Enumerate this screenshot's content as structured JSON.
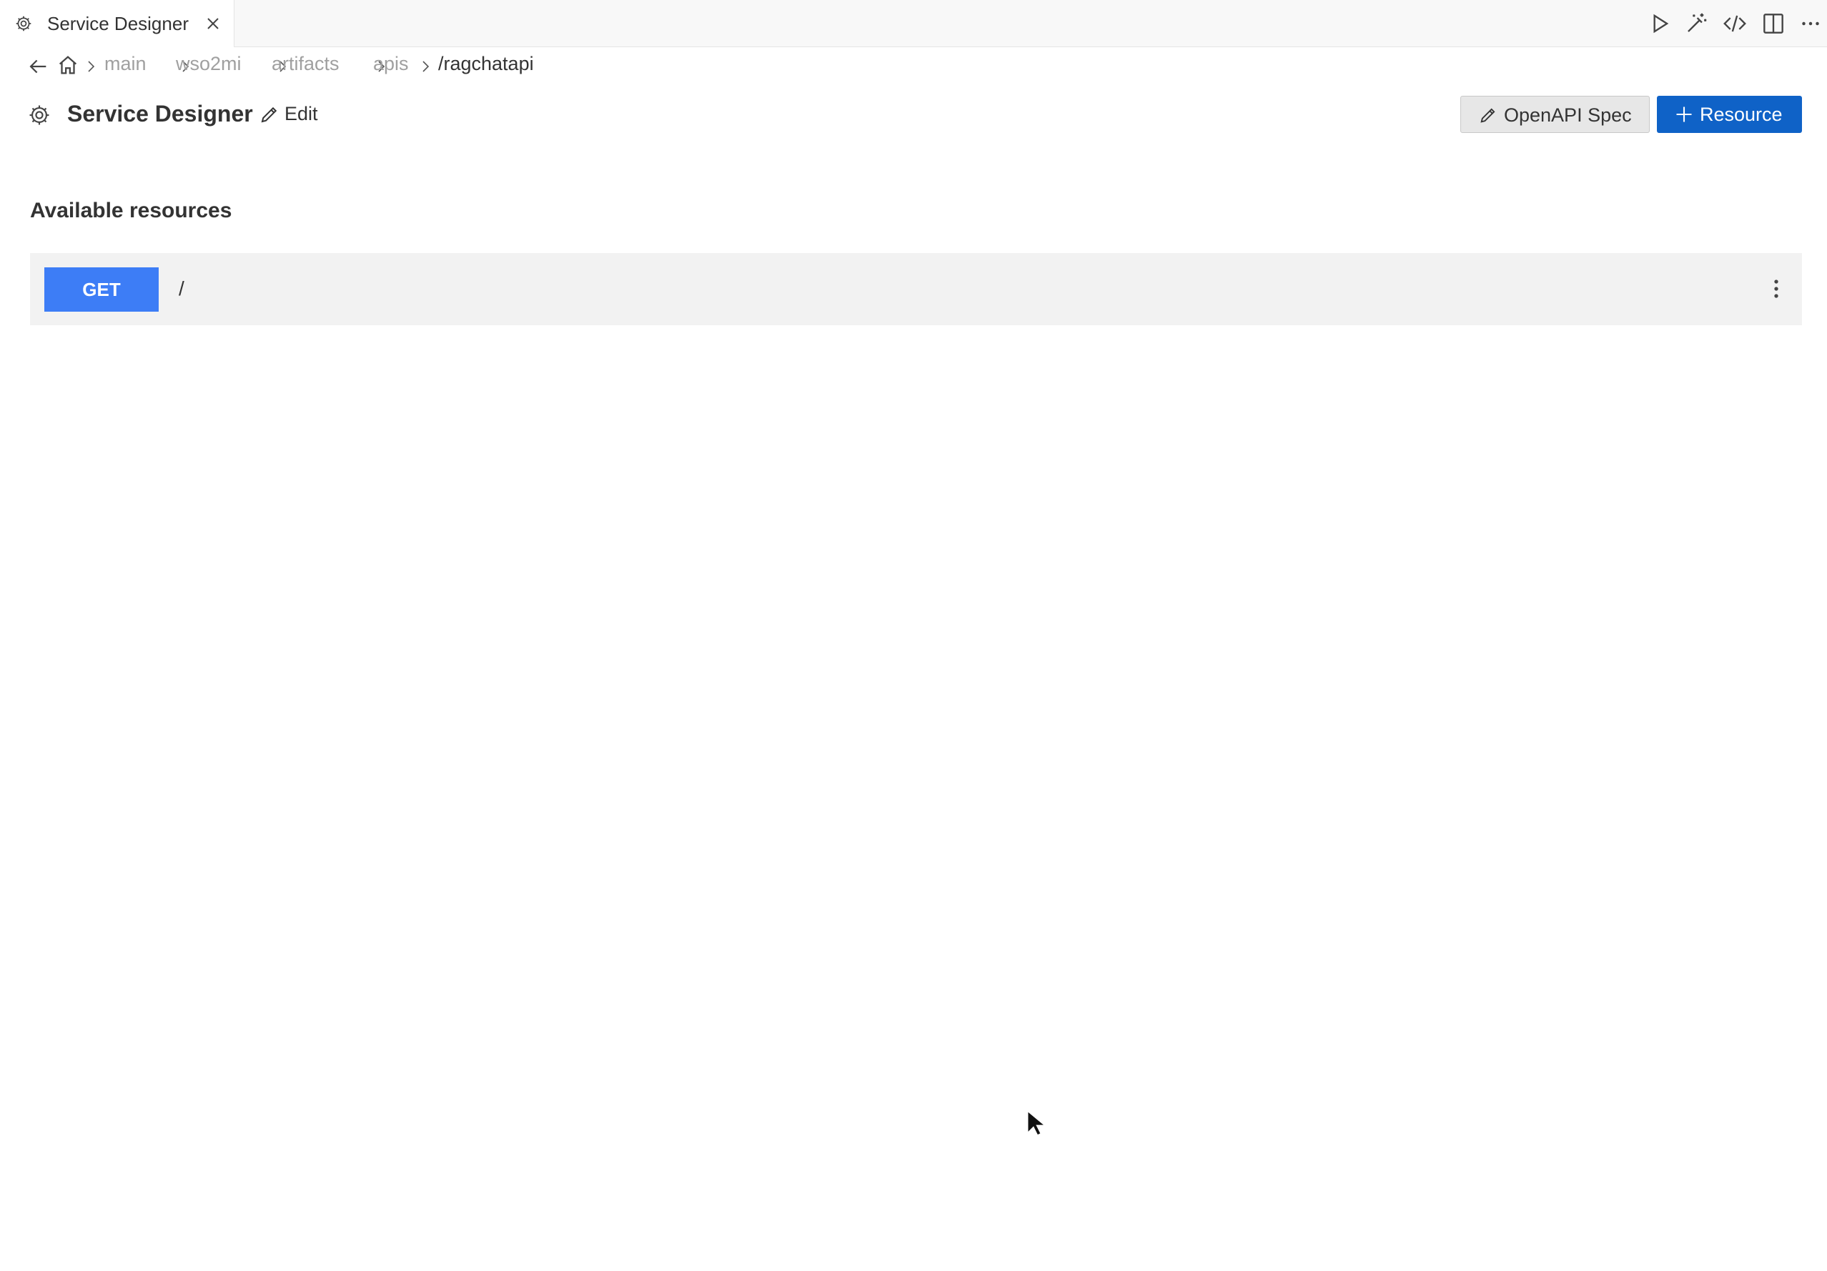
{
  "tab": {
    "title": "Service Designer",
    "icon": "gear-icon",
    "close_icon": "close-icon"
  },
  "toolbar": {
    "icons": [
      "run-icon",
      "magic-wand-icon",
      "code-view-icon",
      "split-editor-icon",
      "more-actions-icon"
    ]
  },
  "breadcrumb": {
    "items": [
      "main",
      "wso2mi",
      "artifacts",
      "apis",
      "/ragchatapi"
    ]
  },
  "header": {
    "title": "Service Designer",
    "edit_label": "Edit",
    "openapi_label": "OpenAPI Spec",
    "resource_label": "Resource"
  },
  "resources": {
    "section_title": "Available resources",
    "items": [
      {
        "method": "GET",
        "path": "/"
      }
    ]
  },
  "colors": {
    "primary_button": "#0f62c7",
    "get_badge": "#3d7df6",
    "breadcrumb_inactive": "#a0a0a0"
  }
}
